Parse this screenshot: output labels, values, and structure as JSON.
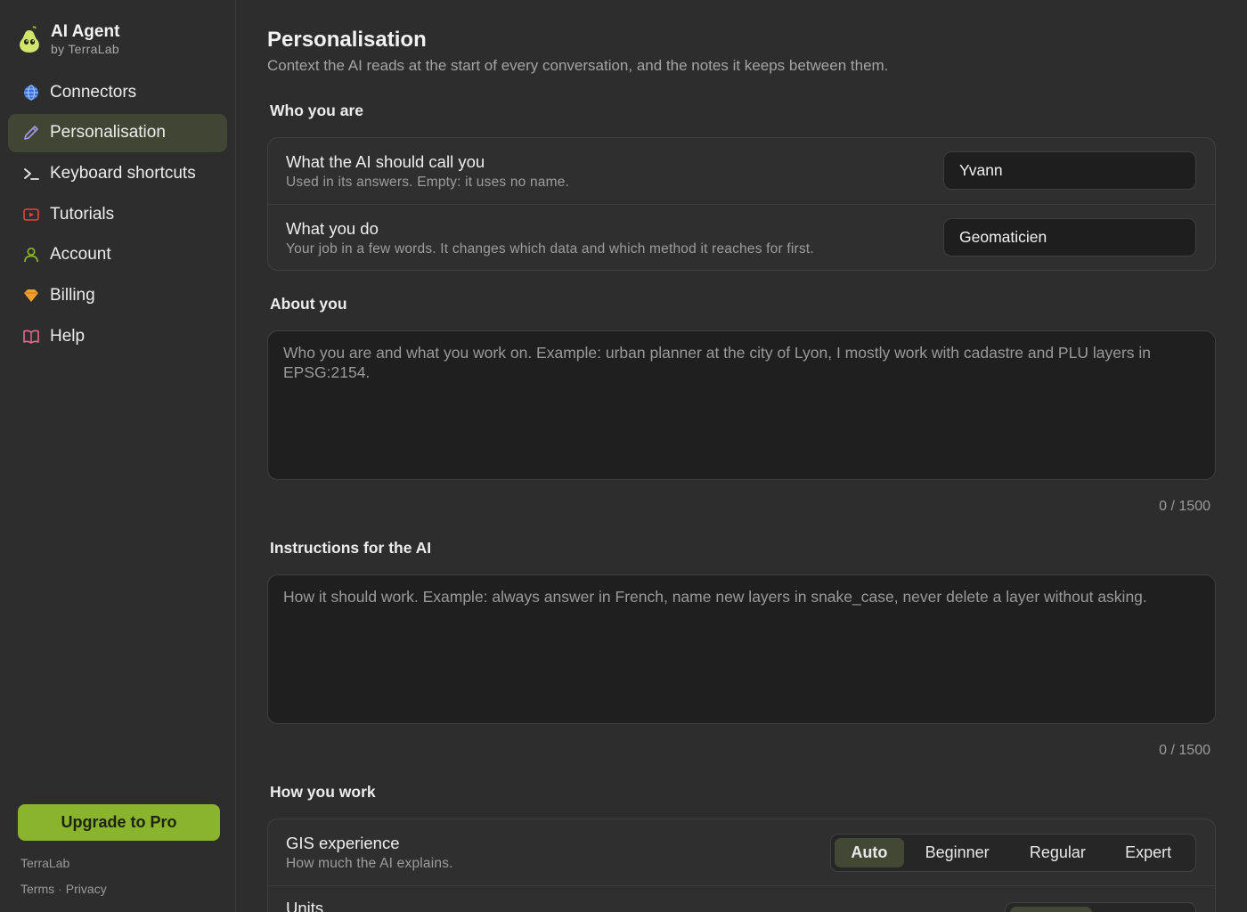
{
  "brand": {
    "title": "AI Agent",
    "subtitle": "by TerraLab"
  },
  "sidebar": {
    "items": [
      {
        "label": "Connectors",
        "icon": "globe-icon"
      },
      {
        "label": "Personalisation",
        "icon": "pencil-icon",
        "active": true
      },
      {
        "label": "Keyboard shortcuts",
        "icon": "terminal-icon"
      },
      {
        "label": "Tutorials",
        "icon": "play-icon"
      },
      {
        "label": "Account",
        "icon": "user-icon"
      },
      {
        "label": "Billing",
        "icon": "diamond-icon"
      },
      {
        "label": "Help",
        "icon": "book-icon"
      }
    ],
    "upgrade_label": "Upgrade to Pro",
    "footer_brand": "TerraLab",
    "footer_terms": "Terms",
    "footer_privacy": "Privacy"
  },
  "page": {
    "title": "Personalisation",
    "subtitle": "Context the AI reads at the start of every conversation, and the notes it keeps between them."
  },
  "who": {
    "title": "Who you are",
    "name_label": "What the AI should call you",
    "name_desc": "Used in its answers. Empty: it uses no name.",
    "name_value": "Yvann",
    "job_label": "What you do",
    "job_desc": "Your job in a few words. It changes which data and which method it reaches for first.",
    "job_value": "Geomaticien"
  },
  "about": {
    "title": "About you",
    "placeholder": "Who you are and what you work on. Example: urban planner at the city of Lyon, I mostly work with cadastre and PLU layers in EPSG:2154.",
    "counter": "0 / 1500"
  },
  "instructions": {
    "title": "Instructions for the AI",
    "placeholder": "How it should work. Example: always answer in French, name new layers in snake_case, never delete a layer without asking.",
    "counter": "0 / 1500"
  },
  "work": {
    "title": "How you work",
    "gis_label": "GIS experience",
    "gis_desc": "How much the AI explains.",
    "gis_options": [
      "Auto",
      "Beginner",
      "Regular",
      "Expert"
    ],
    "gis_selected": "Auto",
    "units_label": "Units"
  },
  "colors": {
    "accent": "#8ab32e",
    "active_bg": "#414634",
    "background": "#2d2d2d"
  }
}
